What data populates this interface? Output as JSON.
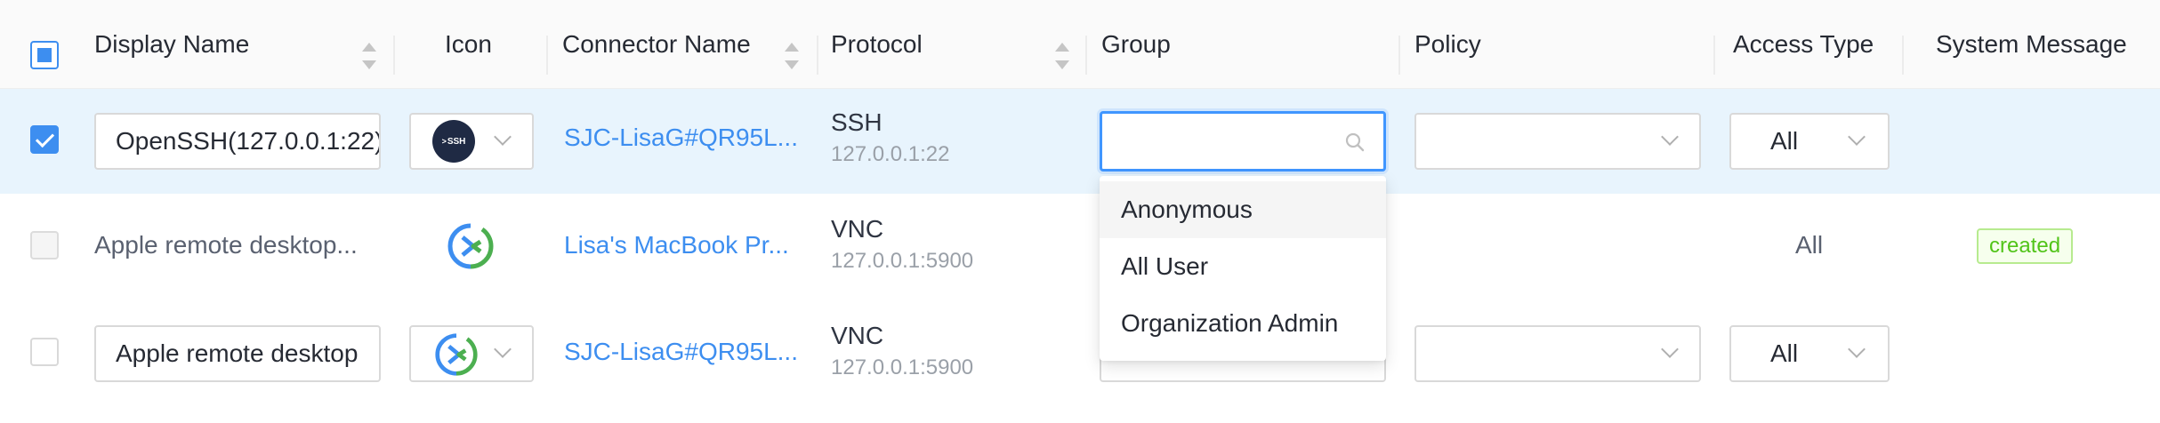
{
  "columns": {
    "display_name": "Display Name",
    "icon": "Icon",
    "connector_name": "Connector Name",
    "protocol": "Protocol",
    "group": "Group",
    "policy": "Policy",
    "access_type": "Access Type",
    "system_message": "System Message"
  },
  "rows": [
    {
      "selected": true,
      "display_name": "OpenSSH(127.0.0.1:22)",
      "icon": "ssh-icon",
      "icon_label": "SSH",
      "connector": "SJC-LisaG#QR95L...",
      "protocol": "SSH",
      "address": "127.0.0.1:22",
      "group": "",
      "policy": "",
      "access_type": "All",
      "system_message": ""
    },
    {
      "selected": false,
      "display_name": "Apple remote desktop...",
      "icon": "remote-desktop-icon",
      "connector": "Lisa's MacBook Pr...",
      "protocol": "VNC",
      "address": "127.0.0.1:5900",
      "access_type": "All",
      "system_message": "created"
    },
    {
      "selected": false,
      "display_name": "Apple remote desktop",
      "icon": "remote-desktop-icon",
      "connector": "SJC-LisaG#QR95L...",
      "protocol": "VNC",
      "address": "127.0.0.1:5900",
      "policy": "",
      "access_type": "All",
      "system_message": ""
    }
  ],
  "group_dropdown": {
    "options": [
      "Anonymous",
      "All User",
      "Organization Admin"
    ]
  },
  "colors": {
    "accent": "#3d8ef0",
    "selected_row": "#e8f4fd",
    "created_tag": "#52c41a"
  }
}
